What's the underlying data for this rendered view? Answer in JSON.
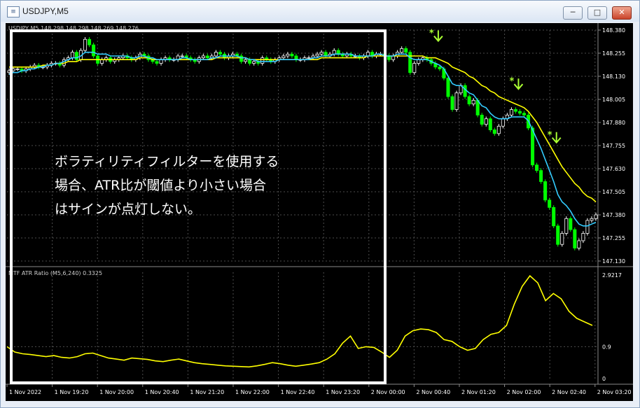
{
  "window": {
    "title": "USDJPY,M5",
    "icon": "chart-window-icon",
    "buttons": {
      "minimize": "─",
      "maximize": "□",
      "close": "✕"
    }
  },
  "chart_data": [
    {
      "type": "candlestick",
      "pane": "main",
      "info_label": "USDJPY,M5  148.298 148.298 148.269 148.276",
      "price_ticks": [
        "148.380",
        "148.255",
        "148.130",
        "148.005",
        "147.880",
        "147.755",
        "147.630",
        "147.505",
        "147.380",
        "147.255",
        "147.130"
      ],
      "ylim": [
        147.13,
        148.38
      ],
      "candle_count": 140,
      "close": [
        148.16,
        148.17,
        148.17,
        148.16,
        148.17,
        148.18,
        148.19,
        148.18,
        148.18,
        148.19,
        148.2,
        148.2,
        148.19,
        148.22,
        148.23,
        148.26,
        148.22,
        148.27,
        148.33,
        148.3,
        148.24,
        148.2,
        148.22,
        148.23,
        148.21,
        148.22,
        148.23,
        148.24,
        148.23,
        148.22,
        148.23,
        148.25,
        148.24,
        148.22,
        148.21,
        148.2,
        148.22,
        148.23,
        148.22,
        148.22,
        148.24,
        148.24,
        148.23,
        148.22,
        148.21,
        148.23,
        148.24,
        148.23,
        148.24,
        148.26,
        148.25,
        148.23,
        148.24,
        148.25,
        148.24,
        148.21,
        148.22,
        148.2,
        148.21,
        148.2,
        148.23,
        148.22,
        148.21,
        148.22,
        148.23,
        148.24,
        148.25,
        148.24,
        148.22,
        148.22,
        148.23,
        148.23,
        148.24,
        148.25,
        148.26,
        148.24,
        148.25,
        148.27,
        148.25,
        148.24,
        148.25,
        148.24,
        148.24,
        148.23,
        148.24,
        148.26,
        148.24,
        148.25,
        148.25,
        148.24,
        148.22,
        148.24,
        148.26,
        148.28,
        148.26,
        148.15,
        148.2,
        148.22,
        148.23,
        148.22,
        148.2,
        148.18,
        148.17,
        148.12,
        148.02,
        147.95,
        148.04,
        148.08,
        148.02,
        147.98,
        148.0,
        147.92,
        147.87,
        147.9,
        147.84,
        147.82,
        147.86,
        147.9,
        147.92,
        147.95,
        147.94,
        147.93,
        147.92,
        147.85,
        147.65,
        147.62,
        147.56,
        147.46,
        147.42,
        147.32,
        147.22,
        147.28,
        147.36,
        147.3,
        147.2,
        147.24,
        147.28,
        147.35,
        147.36,
        147.38
      ],
      "series": [
        {
          "name": "",
          "color": "#ffff00",
          "values": [
            148.18,
            148.18,
            148.18,
            148.18,
            148.18,
            148.18,
            148.18,
            148.18,
            148.19,
            148.19,
            148.19,
            148.2,
            148.2,
            148.2,
            148.21,
            148.21,
            148.21,
            148.22,
            148.22,
            148.22,
            148.22,
            148.22,
            148.22,
            148.22,
            148.22,
            148.22,
            148.22,
            148.22,
            148.22,
            148.22,
            148.22,
            148.23,
            148.23,
            148.23,
            148.22,
            148.22,
            148.22,
            148.22,
            148.22,
            148.22,
            148.22,
            148.22,
            148.22,
            148.22,
            148.22,
            148.22,
            148.22,
            148.22,
            148.22,
            148.23,
            148.23,
            148.23,
            148.23,
            148.23,
            148.23,
            148.23,
            148.23,
            148.22,
            148.22,
            148.22,
            148.22,
            148.22,
            148.22,
            148.22,
            148.22,
            148.22,
            148.22,
            148.22,
            148.22,
            148.22,
            148.22,
            148.22,
            148.22,
            148.22,
            148.23,
            148.23,
            148.23,
            148.23,
            148.23,
            148.23,
            148.23,
            148.23,
            148.23,
            148.23,
            148.23,
            148.24,
            148.24,
            148.24,
            148.24,
            148.24,
            148.24,
            148.24,
            148.24,
            148.24,
            148.24,
            148.24,
            148.24,
            148.24,
            148.24,
            148.23,
            148.23,
            148.23,
            148.22,
            148.21,
            148.2,
            148.18,
            148.17,
            148.16,
            148.15,
            148.13,
            148.12,
            148.1,
            148.08,
            148.07,
            148.05,
            148.04,
            148.02,
            148.01,
            148.0,
            147.99,
            147.98,
            147.97,
            147.96,
            147.94,
            147.91,
            147.88,
            147.84,
            147.8,
            147.76,
            147.72,
            147.68,
            147.64,
            147.61,
            147.58,
            147.55,
            147.53,
            147.5,
            147.48,
            147.47,
            147.45
          ]
        },
        {
          "name": "",
          "color": "#33ccff",
          "values": [
            148.14,
            148.15,
            148.15,
            148.16,
            148.16,
            148.17,
            148.17,
            148.18,
            148.18,
            148.19,
            148.19,
            148.2,
            148.2,
            148.21,
            148.22,
            148.23,
            148.23,
            148.24,
            148.26,
            148.26,
            148.26,
            148.25,
            148.25,
            148.25,
            148.24,
            148.24,
            148.24,
            148.24,
            148.24,
            148.23,
            148.23,
            148.24,
            148.24,
            148.23,
            148.23,
            148.22,
            148.22,
            148.22,
            148.22,
            148.22,
            148.22,
            148.23,
            148.23,
            148.22,
            148.22,
            148.22,
            148.22,
            148.22,
            148.23,
            148.23,
            148.24,
            148.24,
            148.24,
            148.24,
            148.24,
            148.23,
            148.23,
            148.22,
            148.22,
            148.21,
            148.21,
            148.21,
            148.21,
            148.21,
            148.22,
            148.22,
            148.22,
            148.22,
            148.22,
            148.22,
            148.22,
            148.22,
            148.23,
            148.23,
            148.24,
            148.24,
            148.24,
            148.25,
            148.25,
            148.25,
            148.25,
            148.25,
            148.24,
            148.24,
            148.24,
            148.24,
            148.24,
            148.25,
            148.25,
            148.24,
            148.24,
            148.24,
            148.25,
            148.25,
            148.25,
            148.23,
            148.22,
            148.22,
            148.22,
            148.22,
            148.21,
            148.2,
            148.19,
            148.17,
            148.13,
            148.09,
            148.08,
            148.08,
            148.06,
            148.04,
            148.03,
            148.0,
            147.97,
            147.96,
            147.93,
            147.91,
            147.9,
            147.9,
            147.9,
            147.91,
            147.91,
            147.91,
            147.91,
            147.89,
            147.84,
            147.79,
            147.74,
            147.68,
            147.62,
            147.56,
            147.49,
            147.45,
            147.43,
            147.4,
            147.36,
            147.33,
            147.32,
            147.32,
            147.33,
            147.34
          ]
        }
      ],
      "signal_markers": [
        {
          "index": 101,
          "price": 148.34,
          "label": "*"
        },
        {
          "index": 120,
          "price": 148.08,
          "label": "*"
        },
        {
          "index": 129,
          "price": 147.79,
          "label": "*"
        }
      ],
      "colors": {
        "bull": "#ffffff",
        "bear": "#00ff00",
        "grid": "#4d4d4d",
        "background": "#000000"
      }
    },
    {
      "type": "line",
      "pane": "indicator",
      "title": "MTF ATR Ratio  (M5,6,240) 0.3325",
      "ylim": [
        0,
        2.9217
      ],
      "y_ticks": [
        "2.9217",
        "0.9",
        "0"
      ],
      "series": [
        {
          "name": "",
          "color": "#ffff00",
          "values": [
            0.9,
            0.75,
            0.7,
            0.68,
            0.65,
            0.62,
            0.65,
            0.6,
            0.58,
            0.62,
            0.7,
            0.72,
            0.65,
            0.58,
            0.55,
            0.52,
            0.58,
            0.56,
            0.54,
            0.5,
            0.48,
            0.52,
            0.55,
            0.5,
            0.45,
            0.42,
            0.4,
            0.38,
            0.36,
            0.35,
            0.34,
            0.33,
            0.36,
            0.4,
            0.45,
            0.42,
            0.38,
            0.35,
            0.38,
            0.41,
            0.45,
            0.55,
            0.7,
            1.0,
            1.2,
            0.85,
            0.9,
            0.88,
            0.75,
            0.6,
            0.8,
            1.2,
            1.35,
            1.4,
            1.38,
            1.3,
            1.1,
            1.05,
            0.9,
            0.8,
            0.85,
            1.1,
            1.25,
            1.3,
            1.5,
            2.1,
            2.6,
            2.9,
            2.7,
            2.2,
            2.4,
            2.25,
            1.9,
            1.7,
            1.6,
            1.5
          ]
        }
      ]
    }
  ],
  "x_ticks": [
    "1 Nov 2022",
    "1 Nov 19:20",
    "1 Nov 20:00",
    "1 Nov 20:40",
    "1 Nov 21:20",
    "1 Nov 22:00",
    "1 Nov 22:40",
    "1 Nov 23:20",
    "2 Nov 00:00",
    "2 Nov 00:40",
    "2 Nov 01:20",
    "2 Nov 02:00",
    "2 Nov 02:40",
    "2 Nov 03:20"
  ],
  "annotation": {
    "lines": [
      "ボラティリティフィルターを使用する",
      "場合、ATR比が閾値より小さい場合",
      "はサインが点灯しない。"
    ],
    "box_color": "#ffffff"
  }
}
